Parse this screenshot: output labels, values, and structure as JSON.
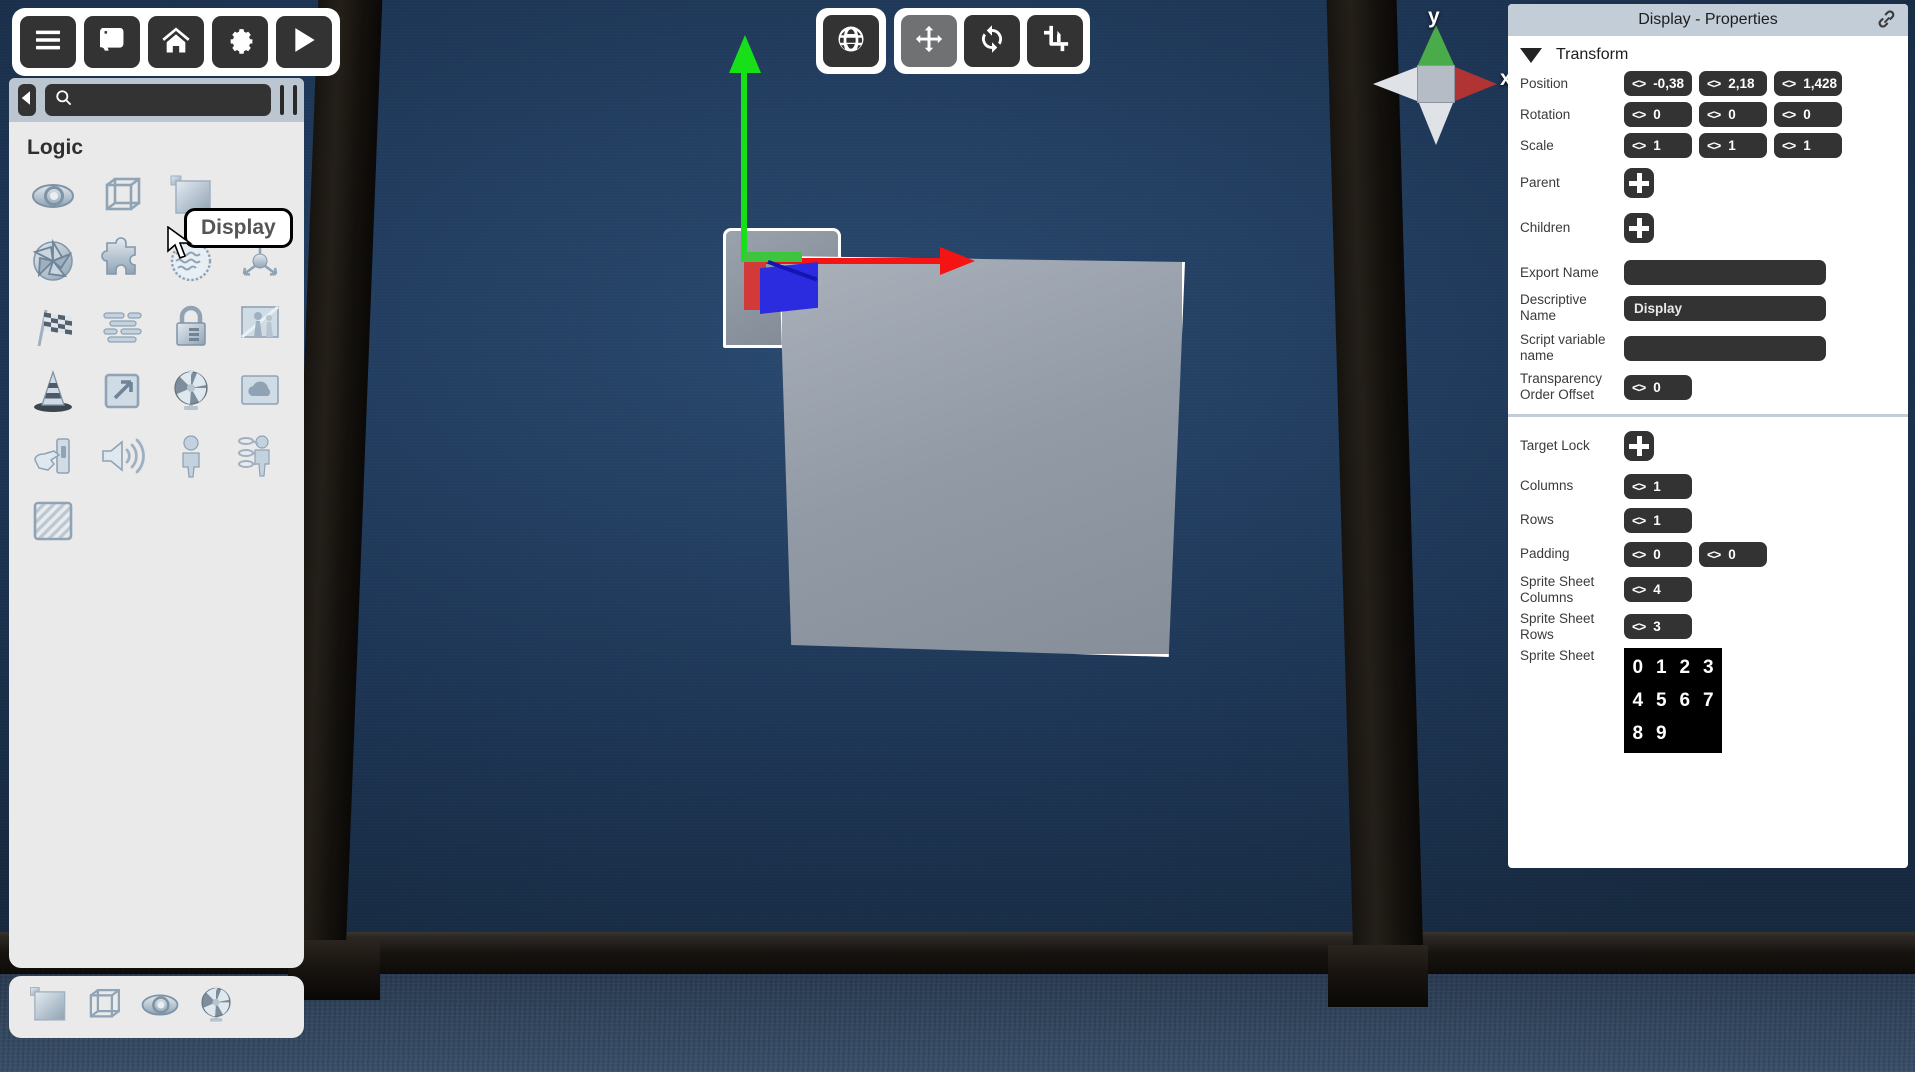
{
  "app": {
    "viewport_toolbar": {
      "space_button": {
        "label": "",
        "icon": "globe-icon",
        "active": false
      },
      "tools": [
        {
          "name": "move",
          "icon": "move-icon",
          "active": true
        },
        {
          "name": "rotate",
          "icon": "rotate-icon",
          "active": false
        },
        {
          "name": "scale",
          "icon": "crop-scale-icon",
          "active": false
        }
      ]
    },
    "nav_gizmo": {
      "x_label": "x",
      "y_label": "y"
    }
  },
  "left_toolbar": {
    "buttons": [
      {
        "name": "menu",
        "icon": "hamburger-menu-icon"
      },
      {
        "name": "assets",
        "icon": "scroll-document-icon"
      },
      {
        "name": "home",
        "icon": "home-icon"
      },
      {
        "name": "settings",
        "icon": "gear-icon"
      },
      {
        "name": "play",
        "icon": "play-icon"
      }
    ]
  },
  "left_panel": {
    "collapse_icon": "chevron-left-icon",
    "search": {
      "value": "",
      "placeholder": "",
      "icon": "search-icon"
    },
    "view_toggles": [
      {
        "name": "toggle-list-view",
        "style": "white"
      },
      {
        "name": "toggle-grid-view",
        "style": "dark"
      },
      {
        "name": "toggle-detail-view",
        "style": "white"
      }
    ],
    "section_title": "Logic",
    "tooltip": "Display",
    "items": [
      {
        "label": "eye",
        "icon": "eye-icon"
      },
      {
        "label": "wireframe-cube",
        "icon": "wireframe-cube-icon"
      },
      {
        "label": "Display",
        "icon": "display-panel-icon"
      },
      {
        "label": "aperture",
        "icon": "aperture-icon"
      },
      {
        "label": "puzzle",
        "icon": "puzzle-piece-icon"
      },
      {
        "label": "water",
        "icon": "water-waves-icon"
      },
      {
        "label": "axis",
        "icon": "axis-gizmo-icon"
      },
      {
        "label": "flag",
        "icon": "checkered-flag-icon"
      },
      {
        "label": "text",
        "icon": "text-lines-icon"
      },
      {
        "label": "lock",
        "icon": "padlock-icon"
      },
      {
        "label": "mirror",
        "icon": "mirror-reflection-icon"
      },
      {
        "label": "cone",
        "icon": "traffic-cone-icon"
      },
      {
        "label": "external",
        "icon": "external-link-icon"
      },
      {
        "label": "fan",
        "icon": "fan-icon"
      },
      {
        "label": "sky",
        "icon": "cloud-sky-icon"
      },
      {
        "label": "switch",
        "icon": "hand-switch-icon"
      },
      {
        "label": "sound",
        "icon": "speaker-sound-icon"
      },
      {
        "label": "person",
        "icon": "person-icon"
      },
      {
        "label": "ragdoll",
        "icon": "ragdoll-icon"
      },
      {
        "label": "hatch",
        "icon": "hatched-square-icon"
      }
    ],
    "recent": [
      {
        "label": "display",
        "icon": "display-panel-icon"
      },
      {
        "label": "wireframe-cube",
        "icon": "wireframe-cube-icon"
      },
      {
        "label": "eye",
        "icon": "eye-icon"
      },
      {
        "label": "fan",
        "icon": "fan-icon"
      }
    ]
  },
  "properties": {
    "title": "Display - Properties",
    "link_icon": "chain-link-icon",
    "transform": {
      "section_label": "Transform",
      "position": {
        "label": "Position",
        "x": "-0,38",
        "y": "2,18",
        "z": "1,428"
      },
      "rotation": {
        "label": "Rotation",
        "x": "0",
        "y": "0",
        "z": "0"
      },
      "scale": {
        "label": "Scale",
        "x": "1",
        "y": "1",
        "z": "1"
      },
      "parent": {
        "label": "Parent"
      },
      "children": {
        "label": "Children"
      }
    },
    "export_name": {
      "label": "Export Name",
      "value": ""
    },
    "descriptive_name": {
      "label": "Descriptive Name",
      "value": "Display"
    },
    "script_variable_name": {
      "label": "Script variable name",
      "value": ""
    },
    "transparency_order_offset": {
      "label": "Transparency Order Offset",
      "value": "0"
    },
    "target_lock": {
      "label": "Target Lock"
    },
    "columns": {
      "label": "Columns",
      "value": "1"
    },
    "rows": {
      "label": "Rows",
      "value": "1"
    },
    "padding": {
      "label": "Padding",
      "x": "0",
      "y": "0"
    },
    "sprite_sheet_columns": {
      "label": "Sprite Sheet Columns",
      "value": "4"
    },
    "sprite_sheet_rows": {
      "label": "Sprite Sheet Rows",
      "value": "3"
    },
    "sprite_sheet": {
      "label": "Sprite Sheet",
      "cells": [
        "0",
        "1",
        "2",
        "3",
        "4",
        "5",
        "6",
        "7",
        "8",
        "9",
        "",
        ""
      ]
    }
  },
  "colors": {
    "panel_header": "#c3cdd8",
    "field_dark": "#333333",
    "wall": "#1f3a5c",
    "axis_x": "#f51414",
    "axis_y": "#18e018",
    "axis_z": "#2b2be0"
  }
}
